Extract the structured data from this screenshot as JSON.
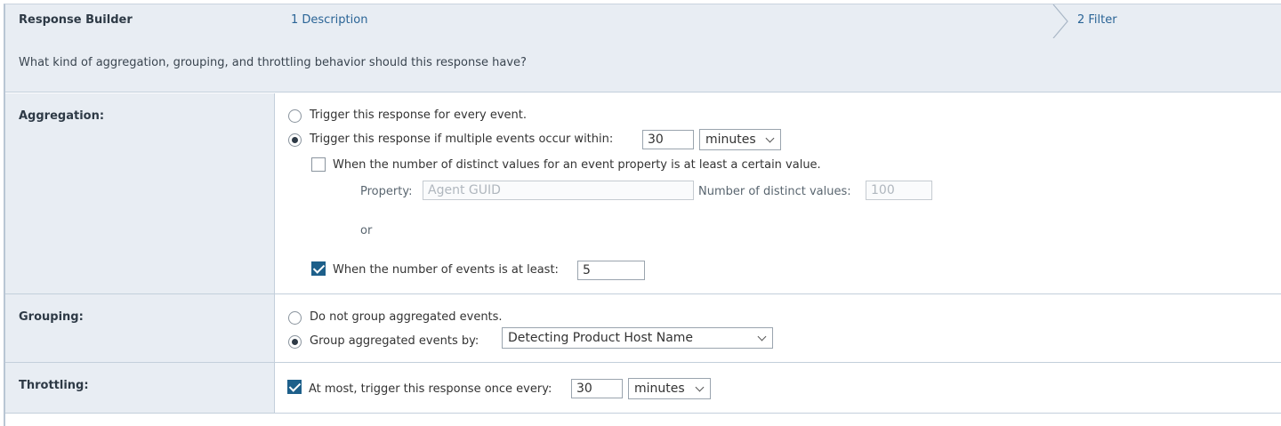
{
  "header": {
    "app_title": "Response Builder",
    "steps": [
      {
        "label": "1 Description"
      },
      {
        "label": "2 Filter"
      }
    ],
    "question": "What kind of aggregation, grouping, and throttling behavior should this response have?"
  },
  "aggregation": {
    "label": "Aggregation:",
    "option_every_event": "Trigger this response for every event.",
    "option_every_event_selected": false,
    "option_multiple": "Trigger this response if multiple events occur within:",
    "option_multiple_selected": true,
    "within_value": "30",
    "within_unit": "minutes",
    "distinct_checkbox_label": "When the number of distinct values for an event property is at least a certain value.",
    "distinct_checked": false,
    "property_label": "Property:",
    "property_placeholder": "Agent GUID",
    "distinct_values_label": "Number of distinct values:",
    "distinct_values_placeholder": "100",
    "or_label": "or",
    "count_checkbox_label": "When the number of events is at least:",
    "count_checked": true,
    "count_value": "5"
  },
  "grouping": {
    "label": "Grouping:",
    "option_none": "Do not group aggregated events.",
    "option_none_selected": false,
    "option_by": "Group aggregated events by:",
    "option_by_selected": true,
    "group_by_value": "Detecting Product Host Name"
  },
  "throttling": {
    "label": "Throttling:",
    "checkbox_label": "At most, trigger this response once every:",
    "checked": true,
    "interval_value": "30",
    "interval_unit": "minutes"
  }
}
